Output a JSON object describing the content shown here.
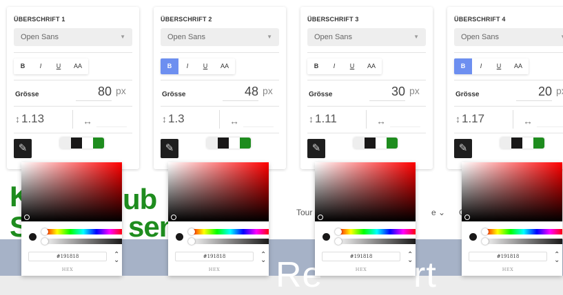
{
  "panels": [
    {
      "title": "ÜBERSCHRIFT 1",
      "font": "Open Sans",
      "bold_active": false,
      "size": "80",
      "line_height": "1.13"
    },
    {
      "title": "ÜBERSCHRIFT 2",
      "font": "Open Sans",
      "bold_active": true,
      "size": "48",
      "line_height": "1.3"
    },
    {
      "title": "ÜBERSCHRIFT 3",
      "font": "Open Sans",
      "bold_active": false,
      "size": "30",
      "line_height": "1.11"
    },
    {
      "title": "ÜBERSCHRIFT 4",
      "font": "Open Sans",
      "bold_active": true,
      "size": "20",
      "line_height": "1.17"
    }
  ],
  "style_buttons": {
    "bold": "B",
    "italic": "I",
    "underline": "U",
    "uppercase": "AA"
  },
  "labels": {
    "size": "Grösse",
    "unit": "px"
  },
  "swatches": [
    "#eeeeee",
    "#191818",
    "#ffffff",
    "#1e8c1e"
  ],
  "picker": {
    "hex_value": "#191818",
    "mode_label": "HEX"
  },
  "icons": {
    "dropdown": "caret-down-icon",
    "line_height": "line-height-icon",
    "letter_spacing": "letter-spacing-icon",
    "pencil": "pencil-icon",
    "mode": "updown-chevron-icon"
  },
  "colors": {
    "accent": "#6d8ff0",
    "brand_green": "#1e8c1e",
    "hero": "#a6b2c7"
  },
  "background": {
    "logo_line1": "K",
    "logo_line1_end": "ub",
    "logo_line2": "S",
    "logo_line2_end": "sen",
    "nav": [
      "Tour",
      "e ⌄",
      "G"
    ],
    "hero_left": "Re",
    "hero_right": "rt"
  }
}
